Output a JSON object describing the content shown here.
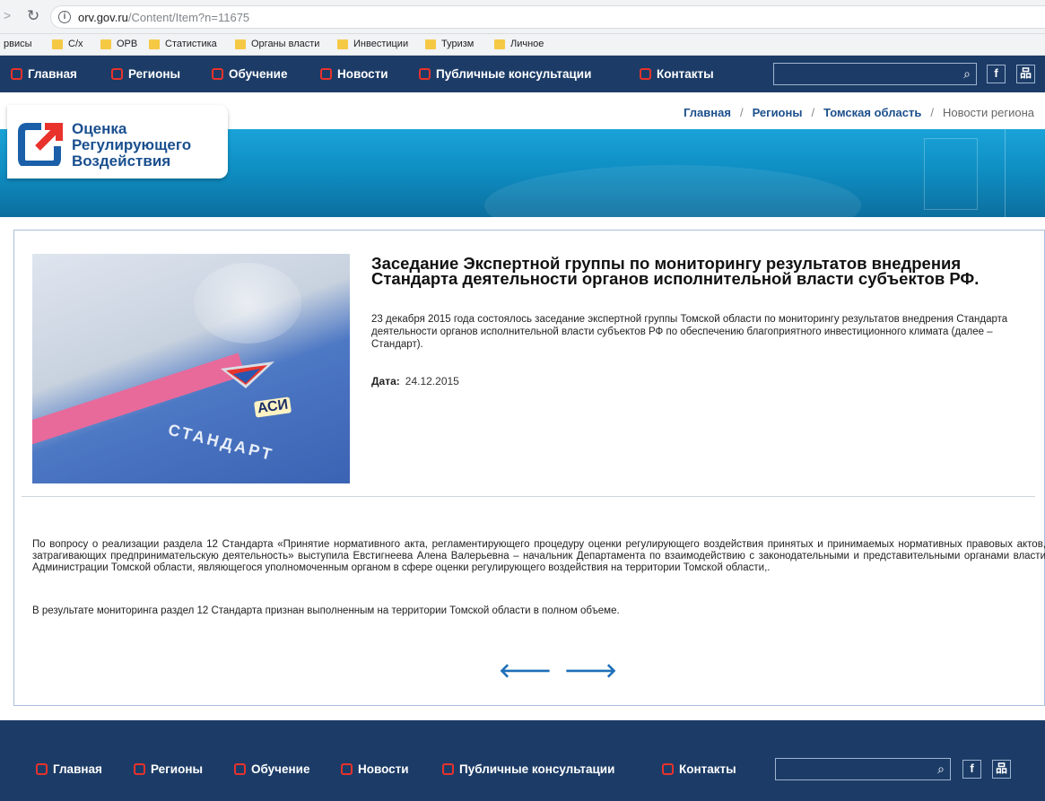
{
  "browser": {
    "url_host": "orv.gov.ru",
    "url_path": "/Content/Item?n=11675",
    "bookmarks": [
      {
        "label": "рвисы",
        "folder": false
      },
      {
        "label": "С/х",
        "folder": true
      },
      {
        "label": "ОРВ",
        "folder": true
      },
      {
        "label": "Статистика",
        "folder": true
      },
      {
        "label": "Органы власти",
        "folder": true
      },
      {
        "label": "Инвестиции",
        "folder": true
      },
      {
        "label": "Туризм",
        "folder": true
      },
      {
        "label": "Личное",
        "folder": true
      }
    ]
  },
  "nav": {
    "items": [
      "Главная",
      "Регионы",
      "Обучение",
      "Новости",
      "Публичные консультации",
      "Контакты"
    ],
    "search_placeholder": "",
    "facebook_label": "f",
    "sitemap_label": "品"
  },
  "breadcrumb": {
    "home": "Главная",
    "regions": "Регионы",
    "region": "Томская область",
    "current": "Новости региона",
    "separator": "/"
  },
  "logo": {
    "line1": "Оценка",
    "line2": "Регулирующего",
    "line3": "Воздействия"
  },
  "article": {
    "image_std_text": "СТАНДАРТ",
    "image_badge_text": "АСИ",
    "title": "Заседание Экспертной группы по мониторингу результатов внедрения Стандарта деятельности органов исполнительной власти субъектов РФ.",
    "summary": "23 декабря 2015 года состоялось заседание экспертной группы Томской области по мониторингу результатов внедрения Стандарта деятельности органов исполнительной власти субъектов РФ по обеспечению благоприятного инвестиционного климата (далее – Стандарт).",
    "date_label": "Дата:",
    "date_value": "24.12.2015",
    "body_p1": "По вопросу о реализации раздела 12 Стандарта «Принятие нормативного акта, регламентирующего процедуру оценки регулирующего воздействия принятых и принимаемых нормативных правовых актов, затрагивающих предпринимательскую деятельность» выступила Евстигнеева Алена Валерьевна – начальник Департамента по взаимодействию с законодательными и представительными органами власти Администрации Томской области, являющегося уполномоченным органом в сфере оценки регулирующего воздействия на территории Томской области,.",
    "body_p2": "В результате мониторинга раздел 12 Стандарта признан выполненным на территории Томской области в полном объеме.",
    "prev_arrow": "🡐",
    "next_arrow": "🡒"
  },
  "colors": {
    "nav_bg": "#1c3c67",
    "accent_red": "#e8322b",
    "link_blue": "#1c4f8c",
    "hero_blue": "#1aa3d8"
  }
}
